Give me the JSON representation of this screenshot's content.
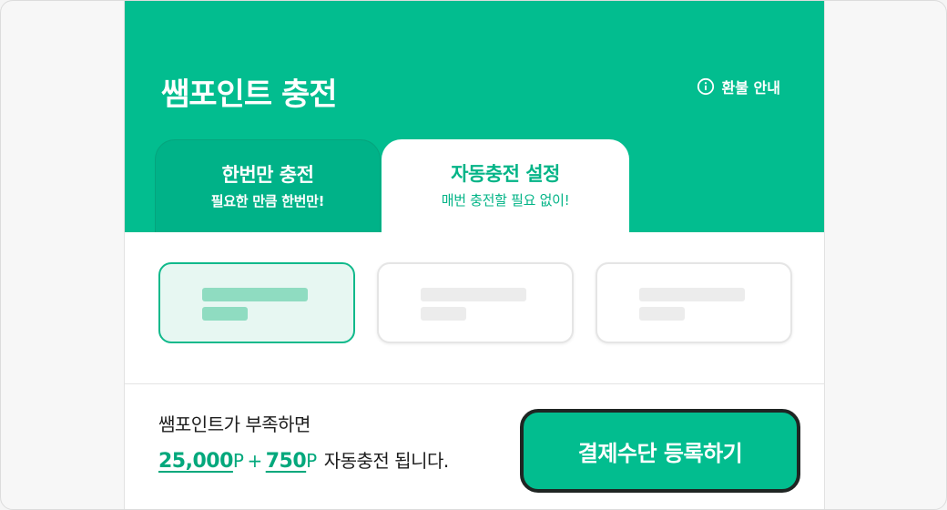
{
  "header": {
    "title": "쌤포인트 충전",
    "refund_label": "환불 안내",
    "refund_icon": "info-icon"
  },
  "tabs": [
    {
      "label": "한번만 충전",
      "sublabel": "필요한 만큼 한번만!",
      "active": false
    },
    {
      "label": "자동충전 설정",
      "sublabel": "매번 충전할 필요 없이!",
      "active": true
    }
  ],
  "options": [
    {
      "state": "selected"
    },
    {
      "state": "unselected"
    },
    {
      "state": "unselected"
    }
  ],
  "footer": {
    "line1": "쌤포인트가 부족하면",
    "threshold_amount": "25,000",
    "threshold_unit": "P",
    "plus": "+",
    "charge_amount": "750",
    "charge_unit": "P",
    "line2_suffix": "자동충전 됩니다."
  },
  "cta": {
    "label": "결제수단 등록하기"
  },
  "colors": {
    "brand_green": "#02bd8f",
    "dark_green_tab": "#00b288",
    "text_green": "#03a87c",
    "selected_bg": "#e7f7f2",
    "cta_border": "#1f2523"
  }
}
